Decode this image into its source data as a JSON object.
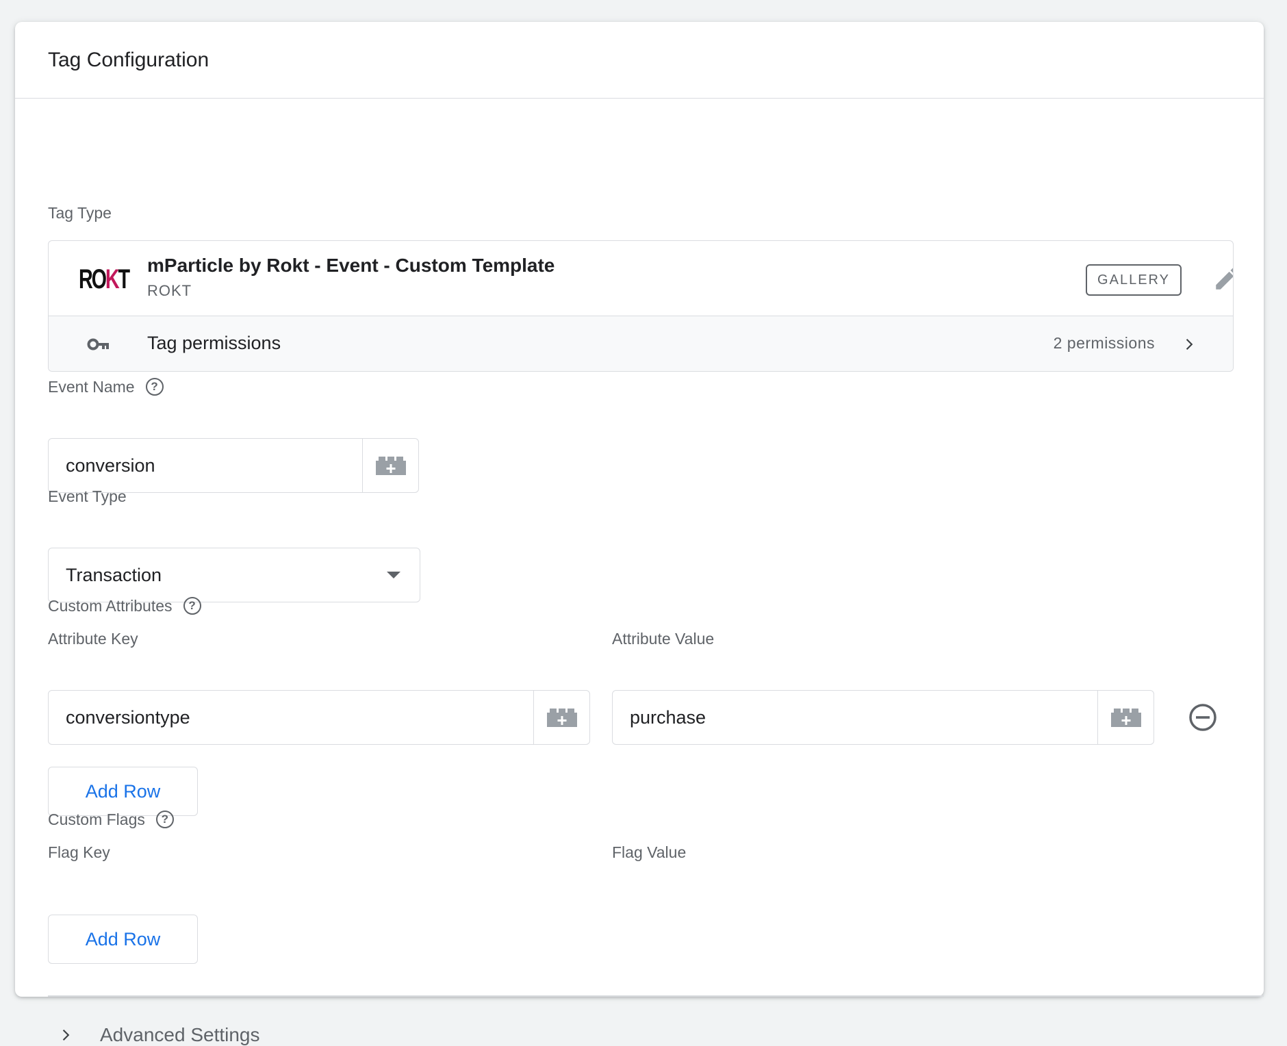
{
  "card": {
    "title": "Tag Configuration"
  },
  "tag_type": {
    "label": "Tag Type",
    "logo_text_1": "RO",
    "logo_text_2": "K",
    "logo_text_3": "T",
    "name": "mParticle by Rokt - Event - Custom Template",
    "vendor": "ROKT",
    "gallery_label": "GALLERY",
    "permissions_label": "Tag permissions",
    "permissions_count": "2 permissions"
  },
  "event_name": {
    "label": "Event Name",
    "help": "?",
    "value": "conversion"
  },
  "event_type": {
    "label": "Event Type",
    "value": "Transaction"
  },
  "custom_attributes": {
    "label": "Custom Attributes",
    "help": "?",
    "key_header": "Attribute Key",
    "value_header": "Attribute Value",
    "rows": [
      {
        "key": "conversiontype",
        "value": "purchase"
      }
    ],
    "add_row_label": "Add Row"
  },
  "custom_flags": {
    "label": "Custom Flags",
    "help": "?",
    "key_header": "Flag Key",
    "value_header": "Flag Value",
    "add_row_label": "Add Row"
  },
  "advanced": {
    "label": "Advanced Settings"
  },
  "colors": {
    "accent": "#1a73e8",
    "text": "#202124",
    "muted": "#5f6368",
    "border": "#dadce0"
  }
}
